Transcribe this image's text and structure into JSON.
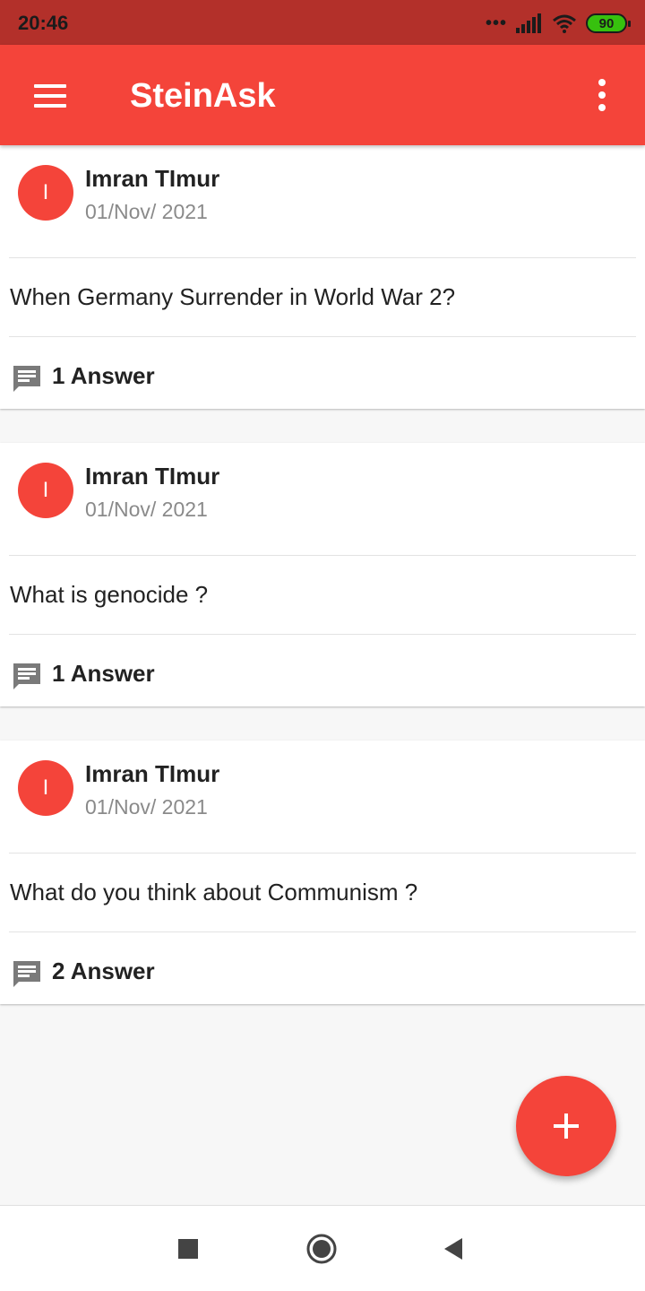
{
  "status_bar": {
    "time": "20:46",
    "signal_dots": "•••",
    "battery_level": "90",
    "icons": [
      "signal-icon",
      "wifi-icon",
      "battery-icon"
    ]
  },
  "app_bar": {
    "title": "SteinAsk",
    "icons": [
      "menu-icon",
      "more-vert-icon"
    ],
    "color": "#f4443a"
  },
  "questions": [
    {
      "avatar_letter": "I",
      "author": "Imran TImur",
      "date": "01/Nov/ 2021",
      "text": "When Germany Surrender in World War 2?",
      "answers": "1 Answer"
    },
    {
      "avatar_letter": "I",
      "author": "Imran TImur",
      "date": "01/Nov/ 2021",
      "text": "What is genocide ?",
      "answers": "1 Answer"
    },
    {
      "avatar_letter": "I",
      "author": "Imran TImur",
      "date": "01/Nov/ 2021",
      "text": "What do you think about Communism ?",
      "answers": "2 Answer"
    }
  ],
  "fab": {
    "icon": "plus-icon"
  },
  "nav_bar": {
    "icons": [
      "recents-icon",
      "home-icon",
      "back-icon"
    ]
  }
}
